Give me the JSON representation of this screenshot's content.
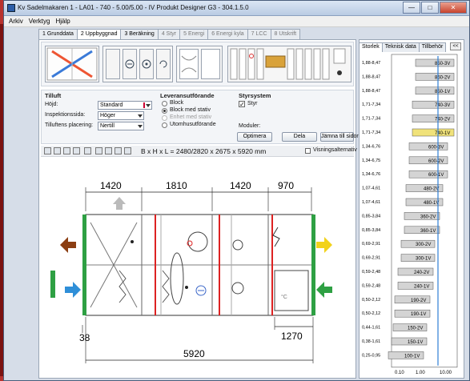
{
  "window": {
    "title": "Kv Sadelmakaren 1 - LA01 - 740 - 5.00/5.00 - IV Produkt Designer G3 - 304.1.5.0",
    "minimize": "—",
    "maximize": "□",
    "close": "✕"
  },
  "menu": [
    "Arkiv",
    "Verktyg",
    "Hjälp"
  ],
  "tabs": [
    {
      "label": "1 Grunddata",
      "state": "enabled"
    },
    {
      "label": "2 Uppbyggnad",
      "state": "active"
    },
    {
      "label": "3 Beräkning",
      "state": "enabled"
    },
    {
      "label": "4 Styr",
      "state": "disabled"
    },
    {
      "label": "5 Energi",
      "state": "disabled"
    },
    {
      "label": "6 Energi kyla",
      "state": "disabled"
    },
    {
      "label": "7 LCC",
      "state": "disabled"
    },
    {
      "label": "8 Utskrift",
      "state": "disabled"
    }
  ],
  "tilluft": {
    "heading": "Tilluft",
    "hojd_label": "Höjd:",
    "hojd_value": "Standard",
    "inspektion_label": "Inspektionssida:",
    "inspektion_value": "Höger",
    "placering_label": "Tilluftens placering:",
    "placering_value": "Nertill"
  },
  "leverans": {
    "heading": "Leveransutförande",
    "options": [
      {
        "label": "Block",
        "selected": false,
        "disabled": false
      },
      {
        "label": "Block med stativ",
        "selected": true,
        "disabled": false
      },
      {
        "label": "Enhet med stativ",
        "selected": false,
        "disabled": true
      },
      {
        "label": "Utomhusutförande",
        "selected": false,
        "disabled": false
      }
    ]
  },
  "styr": {
    "heading": "Styrsystem",
    "styr_label": "Styr",
    "styr_checked": true,
    "moduler_label": "Moduler:",
    "optimera": "Optimera",
    "dela": "Dela",
    "jamna": "Jämna till sidor"
  },
  "dimension_line": "B x H x L = 2480/2820 x 2675 x 5920 mm",
  "visningsalternativ": "Visningsalternativ",
  "dims": {
    "top": [
      "1420",
      "1810",
      "1420",
      "970"
    ],
    "left_small": "38",
    "right_small": "1270",
    "total": "5920"
  },
  "right_tabs": [
    "Storlek",
    "Teknisk data",
    "Tillbehör"
  ],
  "collapse": "<<",
  "size_rows": [
    {
      "range": "1,88-8,47",
      "model": "850-3V"
    },
    {
      "range": "1,88-8,47",
      "model": "850-2V"
    },
    {
      "range": "1,88-8,47",
      "model": "850-1V"
    },
    {
      "range": "1,71-7,34",
      "model": "740-3V"
    },
    {
      "range": "1,71-7,34",
      "model": "740-2V"
    },
    {
      "range": "1,71-7,34",
      "model": "740-1V"
    },
    {
      "range": "1,34-6,76",
      "model": "600-3V"
    },
    {
      "range": "1,34-6,75",
      "model": "600-2V"
    },
    {
      "range": "1,34-6,76",
      "model": "600-1V"
    },
    {
      "range": "1,07-4,61",
      "model": "480-2V"
    },
    {
      "range": "1,07-4,61",
      "model": "480-1V"
    },
    {
      "range": "0,85-3,84",
      "model": "360-2V"
    },
    {
      "range": "0,85-3,84",
      "model": "360-1V"
    },
    {
      "range": "0,69-2,91",
      "model": "300-2V"
    },
    {
      "range": "0,69-2,91",
      "model": "300-1V"
    },
    {
      "range": "0,59-2,48",
      "model": "240-2V"
    },
    {
      "range": "0,59-2,48",
      "model": "240-1V"
    },
    {
      "range": "0,50-2,12",
      "model": "190-2V"
    },
    {
      "range": "0,50-2,12",
      "model": "190-1V"
    },
    {
      "range": "0,44-1,61",
      "model": "150-2V"
    },
    {
      "range": "0,38-1,61",
      "model": "150-1V"
    },
    {
      "range": "0,25-0,95",
      "model": "100-1V"
    }
  ],
  "size_axis": [
    "0.10",
    "1.00",
    "10.00"
  ],
  "selected_model": "740-1V",
  "colors": {
    "selected_row": "#f0e27a",
    "marker": "#2f7fd6"
  }
}
